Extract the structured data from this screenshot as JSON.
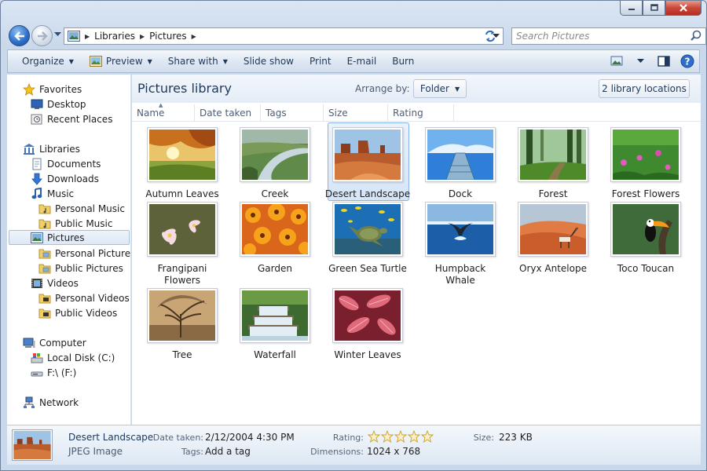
{
  "address": {
    "crumbs": [
      "Libraries",
      "Pictures"
    ],
    "search_placeholder": "Search Pictures"
  },
  "toolbar": {
    "organize": "Organize",
    "preview": "Preview",
    "share_with": "Share with",
    "slide_show": "Slide show",
    "print": "Print",
    "email": "E-mail",
    "burn": "Burn"
  },
  "nav": {
    "favorites": "Favorites",
    "desktop": "Desktop",
    "recent_places": "Recent Places",
    "libraries": "Libraries",
    "documents": "Documents",
    "downloads": "Downloads",
    "music": "Music",
    "personal_music": "Personal Music",
    "public_music": "Public Music",
    "pictures": "Pictures",
    "personal_pictures": "Personal Pictures",
    "public_pictures": "Public Pictures",
    "videos": "Videos",
    "personal_videos": "Personal Videos",
    "public_videos": "Public Videos",
    "computer": "Computer",
    "local_disk": "Local Disk (C:)",
    "f_drive": "F:\\ (F:)",
    "network": "Network"
  },
  "library": {
    "title": "Pictures library",
    "arrange_label": "Arrange by:",
    "arrange_value": "Folder",
    "locations": "2 library locations"
  },
  "columns": {
    "name": "Name",
    "date_taken": "Date taken",
    "tags": "Tags",
    "size": "Size",
    "rating": "Rating"
  },
  "tiles": {
    "autumn_leaves": "Autumn Leaves",
    "creek": "Creek",
    "desert_landscape": "Desert Landscape",
    "dock": "Dock",
    "forest": "Forest",
    "forest_flowers": "Forest Flowers",
    "frangipani_line1": "Frangipani",
    "frangipani_line2": "Flowers",
    "garden": "Garden",
    "green_sea_turtle": "Green Sea Turtle",
    "humpback_line1": "Humpback",
    "humpback_line2": "Whale",
    "oryx_antelope": "Oryx Antelope",
    "toco_toucan": "Toco Toucan",
    "tree": "Tree",
    "waterfall": "Waterfall",
    "winter_leaves": "Winter Leaves"
  },
  "details": {
    "name": "Desert Landscape",
    "type": "JPEG Image",
    "date_label": "Date taken:",
    "date_value": "2/12/2004 4:30 PM",
    "tags_label": "Tags:",
    "tags_value": "Add a tag",
    "rating_label": "Rating:",
    "rating_value": 0,
    "rating_max": 5,
    "dimensions_label": "Dimensions:",
    "dimensions_value": "1024 x 768",
    "size_label": "Size:",
    "size_value": "223 KB"
  },
  "colors": {
    "accent": "#1e395b",
    "selection": "#d5e5f8",
    "close_button": "#c9483a"
  }
}
